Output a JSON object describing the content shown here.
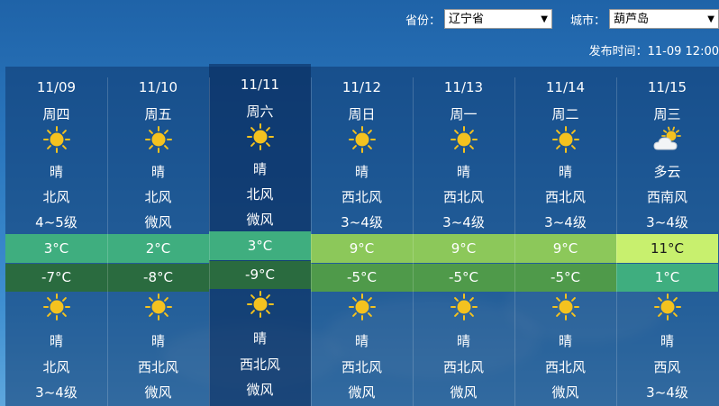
{
  "header": {
    "province_label": "省份：",
    "province_value": "辽宁省",
    "city_label": "城市：",
    "city_value": "葫芦岛",
    "publish_time": "发布时间：11-09 12:00"
  },
  "days": [
    {
      "date": "11/09",
      "weekday": "周四",
      "day_icon": "sun-icon",
      "day_desc": "晴",
      "day_wind": "北风",
      "day_level": "4~5级",
      "high": "3°C",
      "high_color": "#3fae7f",
      "low": "-7°C",
      "low_color": "#2a6b3f",
      "night_icon": "sun-icon",
      "night_desc": "晴",
      "night_wind": "北风",
      "night_level": "3~4级"
    },
    {
      "date": "11/10",
      "weekday": "周五",
      "day_icon": "sun-icon",
      "day_desc": "晴",
      "day_wind": "北风",
      "day_level": "微风",
      "high": "2°C",
      "high_color": "#3fae7f",
      "low": "-8°C",
      "low_color": "#2a6b3f",
      "night_icon": "sun-icon",
      "night_desc": "晴",
      "night_wind": "西北风",
      "night_level": "微风"
    },
    {
      "date": "11/11",
      "weekday": "周六",
      "day_icon": "sun-icon",
      "day_desc": "晴",
      "day_wind": "北风",
      "day_level": "微风",
      "high": "3°C",
      "high_color": "#3fae7f",
      "low": "-9°C",
      "low_color": "#2a6b3f",
      "night_icon": "sun-icon",
      "night_desc": "晴",
      "night_wind": "西北风",
      "night_level": "微风"
    },
    {
      "date": "11/12",
      "weekday": "周日",
      "day_icon": "sun-icon",
      "day_desc": "晴",
      "day_wind": "西北风",
      "day_level": "3~4级",
      "high": "9°C",
      "high_color": "#8cc85a",
      "low": "-5°C",
      "low_color": "#4f9a4a",
      "night_icon": "sun-icon",
      "night_desc": "晴",
      "night_wind": "西北风",
      "night_level": "微风"
    },
    {
      "date": "11/13",
      "weekday": "周一",
      "day_icon": "sun-icon",
      "day_desc": "晴",
      "day_wind": "西北风",
      "day_level": "3~4级",
      "high": "9°C",
      "high_color": "#8cc85a",
      "low": "-5°C",
      "low_color": "#4f9a4a",
      "night_icon": "sun-icon",
      "night_desc": "晴",
      "night_wind": "西北风",
      "night_level": "微风"
    },
    {
      "date": "11/14",
      "weekday": "周二",
      "day_icon": "sun-icon",
      "day_desc": "晴",
      "day_wind": "西北风",
      "day_level": "3~4级",
      "high": "9°C",
      "high_color": "#8cc85a",
      "low": "-5°C",
      "low_color": "#4f9a4a",
      "night_icon": "sun-icon",
      "night_desc": "晴",
      "night_wind": "西北风",
      "night_level": "微风"
    },
    {
      "date": "11/15",
      "weekday": "周三",
      "day_icon": "partly-cloudy-icon",
      "day_desc": "多云",
      "day_wind": "西南风",
      "day_level": "3~4级",
      "high": "11°C",
      "high_color": "#c8f06e",
      "low": "1°C",
      "low_color": "#3fae7f",
      "night_icon": "sun-icon",
      "night_desc": "晴",
      "night_wind": "西风",
      "night_level": "3~4级"
    }
  ],
  "colors": {
    "sun": "#f4c21f",
    "high_text_dark": "#1a1a1a"
  }
}
